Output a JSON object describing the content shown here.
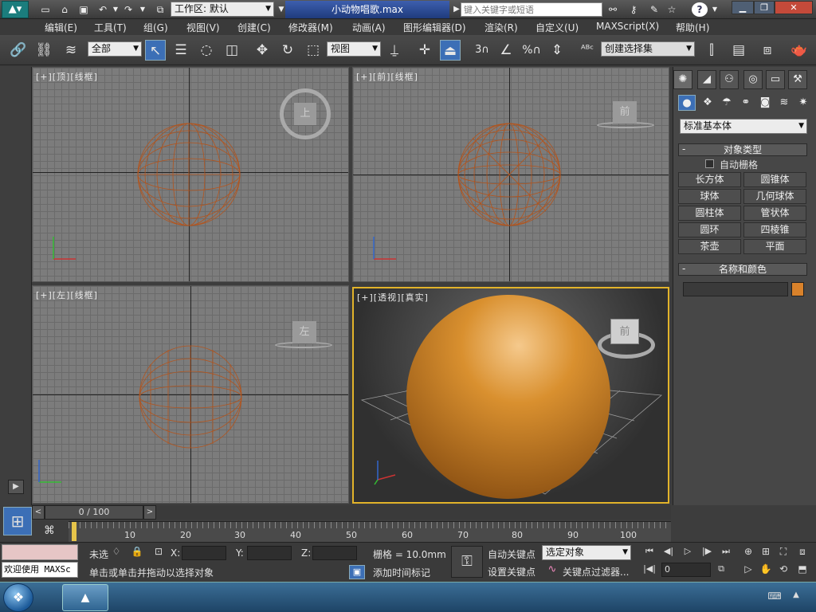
{
  "titlebar": {
    "workspace": "工作区: 默认",
    "doc_title": "小动物唱歌.max",
    "search_placeholder": "键入关键字或短语"
  },
  "menu": [
    "编辑(E)",
    "工具(T)",
    "组(G)",
    "视图(V)",
    "创建(C)",
    "修改器(M)",
    "动画(A)",
    "图形编辑器(D)",
    "渲染(R)",
    "自定义(U)",
    "MAXScript(X)",
    "帮助(H)"
  ],
  "toolbar": {
    "selection_filter": "全部",
    "ref_coord": "视图",
    "snap_label": "3",
    "angle_snap_label": "%",
    "named_selection": "创建选择集"
  },
  "viewports": {
    "top": "[+][顶][线框]",
    "front": "[+][前][线框]",
    "left": "[+][左][线框]",
    "persp": "[+][透视][真实]",
    "cube_top": "上",
    "cube_front": "前",
    "cube_left": "左",
    "cube_persp": "前"
  },
  "command_panel": {
    "category": "标准基本体",
    "object_type_title": "对象类型",
    "autogrid": "自动栅格",
    "buttons": [
      "长方体",
      "圆锥体",
      "球体",
      "几何球体",
      "圆柱体",
      "管状体",
      "圆环",
      "四棱锥",
      "茶壶",
      "平面"
    ],
    "name_color_title": "名称和颜色",
    "object_color": "#d9822b"
  },
  "timeline": {
    "frame": "0 / 100",
    "ticks": [
      "10",
      "20",
      "30",
      "40",
      "50",
      "60",
      "70",
      "80",
      "90",
      "100"
    ]
  },
  "status": {
    "maxscript": "欢迎使用 MAXSc",
    "selected": "未选",
    "x_label": "X:",
    "y_label": "Y:",
    "z_label": "Z:",
    "grid": "栅格 = 10.0mm",
    "auto_key": "自动关键点",
    "set_key": "设置关键点",
    "key_mode": "选定对象",
    "key_filters": "关键点过滤器...",
    "prompt": "单击或单击并拖动以选择对象",
    "add_time_tag": "添加时间标记",
    "current_frame": "0"
  },
  "colors": {
    "wire": "#b4541c",
    "sphere": "#d9902f",
    "active_border": "#e2b32a"
  }
}
